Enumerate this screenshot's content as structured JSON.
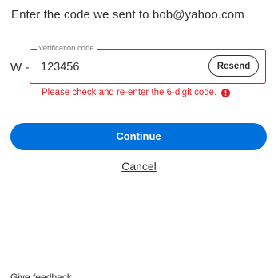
{
  "prompt": {
    "text": "Enter the code we sent to bob@yahoo.com"
  },
  "code_field": {
    "prefix": "W -",
    "legend": "verification code",
    "value": "123456",
    "resend_label": "Resend",
    "border_color": "#de1c24"
  },
  "error": {
    "message": "Please check and re-enter the 6-digit code.",
    "icon": "error-icon",
    "color": "#de1c24"
  },
  "actions": {
    "continue_label": "Continue",
    "continue_color": "#0071dc",
    "cancel_label": "Cancel"
  },
  "footer": {
    "feedback_label": "Give feedback"
  }
}
